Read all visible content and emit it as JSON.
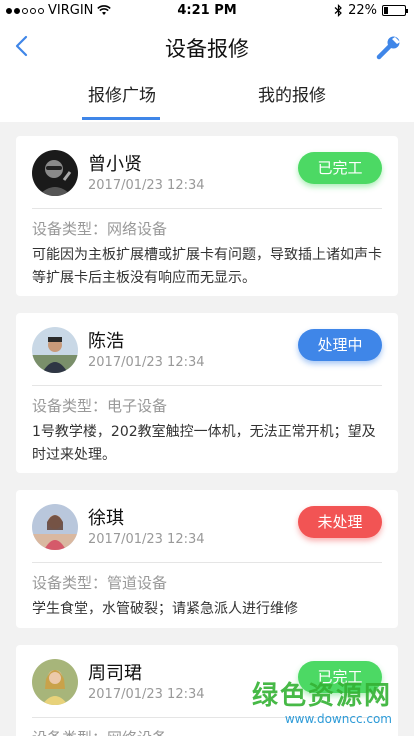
{
  "status": {
    "carrier": "VIRGIN",
    "time": "4:21 PM",
    "battery": "22%"
  },
  "nav": {
    "title": "设备报修"
  },
  "tabs": [
    {
      "label": "报修广场",
      "active": true
    },
    {
      "label": "我的报修",
      "active": false
    }
  ],
  "colors": {
    "accent": "#3f86e8",
    "done": "#4cd964",
    "processing": "#3f86e8",
    "pending": "#f25454"
  },
  "cards": [
    {
      "name": "曾小贤",
      "date": "2017/01/23 12:34",
      "status": "已完工",
      "type": "设备类型：网络设备",
      "desc": "可能因为主板扩展槽或扩展卡有问题，导致插上诸如声卡等扩展卡后主板没有响应而无显示。"
    },
    {
      "name": "陈浩",
      "date": "2017/01/23 12:34",
      "status": "处理中",
      "type": "设备类型：电子设备",
      "desc": "1号教学楼，202教室触控一体机，无法正常开机；望及时过来处理。"
    },
    {
      "name": "徐琪",
      "date": "2017/01/23 12:34",
      "status": "未处理",
      "type": "设备类型：管道设备",
      "desc": "学生食堂，水管破裂；请紧急派人进行维修"
    },
    {
      "name": "周司珺",
      "date": "2017/01/23 12:34",
      "status": "已完工",
      "type": "设备类型：网络设备",
      "desc": ""
    }
  ],
  "watermark": {
    "text": "绿色资源网",
    "url": "www.downcc.com"
  }
}
